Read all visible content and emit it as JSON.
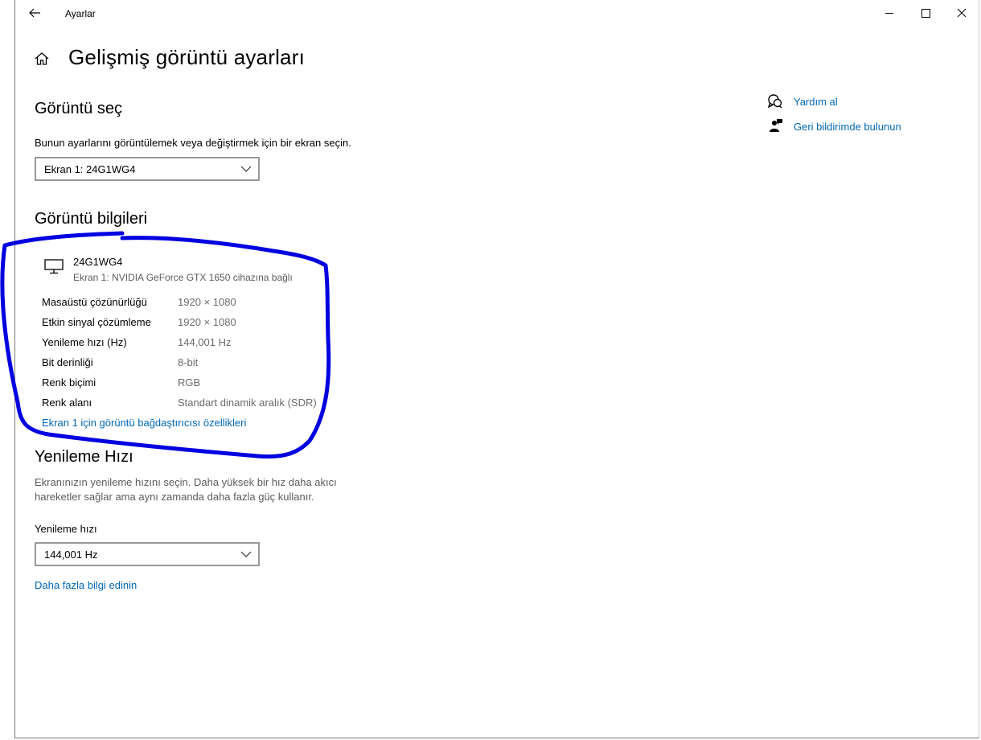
{
  "window": {
    "title": "Ayarlar"
  },
  "page": {
    "title": "Gelişmiş görüntü ayarları"
  },
  "select_display": {
    "heading": "Görüntü seç",
    "description": "Bunun ayarlarını görüntülemek veya değiştirmek için bir ekran seçin.",
    "selected": "Ekran 1: 24G1WG4"
  },
  "display_info": {
    "heading": "Görüntü bilgileri",
    "name": "24G1WG4",
    "subtitle": "Ekran 1: NVIDIA GeForce GTX 1650 cihazına bağlı",
    "rows": [
      {
        "label": "Masaüstü çözünürlüğü",
        "value": "1920 × 1080"
      },
      {
        "label": "Etkin sinyal çözümleme",
        "value": "1920 × 1080"
      },
      {
        "label": "Yenileme hızı (Hz)",
        "value": "144,001 Hz"
      },
      {
        "label": "Bit derinliği",
        "value": "8-bit"
      },
      {
        "label": "Renk biçimi",
        "value": "RGB"
      },
      {
        "label": "Renk alanı",
        "value": "Standart dinamik aralık (SDR)"
      }
    ],
    "adapter_link": "Ekran 1 için görüntü bağdaştırıcısı özellikleri"
  },
  "refresh_rate": {
    "heading": "Yenileme Hızı",
    "description_line1": "Ekranınızın yenileme hızını seçin. Daha yüksek bir hız daha akıcı",
    "description_line2": "hareketler sağlar ama aynı zamanda daha fazla güç kullanır.",
    "field_label": "Yenileme hızı",
    "selected": "144,001 Hz",
    "more_info_link": "Daha fazla bilgi edinin"
  },
  "sidebar": {
    "help_link": "Yardım al",
    "feedback_link": "Geri bildirimde bulunun"
  },
  "colors": {
    "link": "#0067b8",
    "annotation": "#0000e0"
  },
  "icons": [
    "back-arrow-icon",
    "minimize-icon",
    "maximize-icon",
    "close-icon",
    "home-icon",
    "chevron-down-icon",
    "monitor-icon",
    "help-icon",
    "feedback-icon"
  ]
}
